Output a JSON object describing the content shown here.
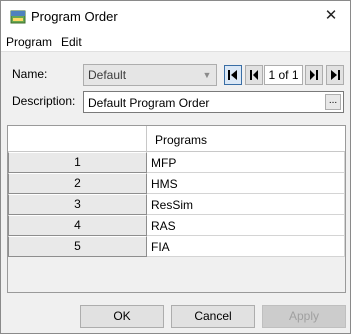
{
  "window": {
    "title": "Program Order",
    "close_glyph": "✕",
    "icon": "program-order-icon"
  },
  "menu": [
    {
      "label": "Program"
    },
    {
      "label": "Edit"
    }
  ],
  "form": {
    "name_label": "Name:",
    "name_value": "Default",
    "description_label": "Description:",
    "description_value": "Default Program Order",
    "ellipsis": "...",
    "page_indicator": "1 of 1"
  },
  "table": {
    "column_header": "Programs",
    "rows": [
      {
        "num": "1",
        "program": "MFP"
      },
      {
        "num": "2",
        "program": "HMS"
      },
      {
        "num": "3",
        "program": "ResSim"
      },
      {
        "num": "4",
        "program": "RAS"
      },
      {
        "num": "5",
        "program": "FIA"
      }
    ]
  },
  "buttons": {
    "ok": "OK",
    "cancel": "Cancel",
    "apply": "Apply"
  }
}
